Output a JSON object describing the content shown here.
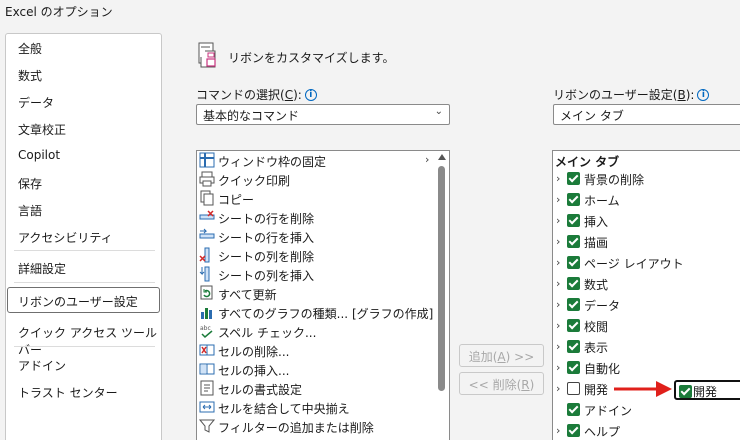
{
  "window": {
    "title": "Excel のオプション"
  },
  "nav": {
    "items": [
      {
        "label": "全般",
        "name": "nav-general"
      },
      {
        "label": "数式",
        "name": "nav-formulas"
      },
      {
        "label": "データ",
        "name": "nav-data"
      },
      {
        "label": "文章校正",
        "name": "nav-proofing"
      },
      {
        "label": "Copilot",
        "name": "nav-copilot"
      },
      {
        "label": "保存",
        "name": "nav-save"
      },
      {
        "label": "言語",
        "name": "nav-language"
      },
      {
        "label": "アクセシビリティ",
        "name": "nav-accessibility"
      },
      {
        "label": "詳細設定",
        "name": "nav-advanced"
      },
      {
        "label": "リボンのユーザー設定",
        "name": "nav-customize-ribbon"
      },
      {
        "label": "クイック アクセス ツール バー",
        "name": "nav-quick-access"
      },
      {
        "label": "アドイン",
        "name": "nav-addins"
      },
      {
        "label": "トラスト センター",
        "name": "nav-trust-center"
      }
    ],
    "selected": "リボンのユーザー設定"
  },
  "main": {
    "heading": "リボンをカスタマイズします。",
    "commands": {
      "label_pre": "コマンドの選択(",
      "label_key": "C",
      "label_post": "):",
      "selected": "基本的なコマンド",
      "items": [
        {
          "label": "ウィンドウ枠の固定",
          "icon": "freeze-panes-icon",
          "submenu": true
        },
        {
          "label": "クイック印刷",
          "icon": "quick-print-icon"
        },
        {
          "label": "コピー",
          "icon": "copy-icon"
        },
        {
          "label": "シートの行を削除",
          "icon": "delete-row-icon"
        },
        {
          "label": "シートの行を挿入",
          "icon": "insert-row-icon"
        },
        {
          "label": "シートの列を削除",
          "icon": "delete-column-icon"
        },
        {
          "label": "シートの列を挿入",
          "icon": "insert-column-icon"
        },
        {
          "label": "すべて更新",
          "icon": "refresh-all-icon"
        },
        {
          "label": "すべてのグラフの種類... [グラフの作成]",
          "icon": "chart-icon"
        },
        {
          "label": "スペル チェック...",
          "icon": "spell-check-icon"
        },
        {
          "label": "セルの削除...",
          "icon": "delete-cells-icon"
        },
        {
          "label": "セルの挿入...",
          "icon": "insert-cells-icon"
        },
        {
          "label": "セルの書式設定",
          "icon": "format-cells-icon"
        },
        {
          "label": "セルを結合して中央揃え",
          "icon": "merge-center-icon"
        },
        {
          "label": "フィルターの追加または削除",
          "icon": "filter-icon"
        }
      ]
    },
    "buttons": {
      "add_pre": "追加(",
      "add_key": "A",
      "add_post": ") >>",
      "remove_pre": "<< 削除(",
      "remove_key": "R",
      "remove_post": ")"
    },
    "ribbon": {
      "label_pre": "リボンのユーザー設定(",
      "label_key": "B",
      "label_post": "):",
      "selected": "メイン タブ",
      "tree_header": "メイン タブ",
      "items": [
        {
          "label": "背景の削除",
          "checked": true,
          "expander": true
        },
        {
          "label": "ホーム",
          "checked": true,
          "expander": true
        },
        {
          "label": "挿入",
          "checked": true,
          "expander": true
        },
        {
          "label": "描画",
          "checked": true,
          "expander": true
        },
        {
          "label": "ページ レイアウト",
          "checked": true,
          "expander": true
        },
        {
          "label": "数式",
          "checked": true,
          "expander": true
        },
        {
          "label": "データ",
          "checked": true,
          "expander": true
        },
        {
          "label": "校閲",
          "checked": true,
          "expander": true
        },
        {
          "label": "表示",
          "checked": true,
          "expander": true
        },
        {
          "label": "自動化",
          "checked": true,
          "expander": true
        },
        {
          "label": "開発",
          "checked": false,
          "expander": true
        },
        {
          "label": "アドイン",
          "checked": true,
          "expander": false
        },
        {
          "label": "ヘルプ",
          "checked": true,
          "expander": true
        }
      ]
    },
    "callout": {
      "label": "開発",
      "checked": true
    },
    "colors": {
      "checkbox": "#1b7b3a",
      "arrow": "#e0201b",
      "info": "#0067c0"
    }
  }
}
